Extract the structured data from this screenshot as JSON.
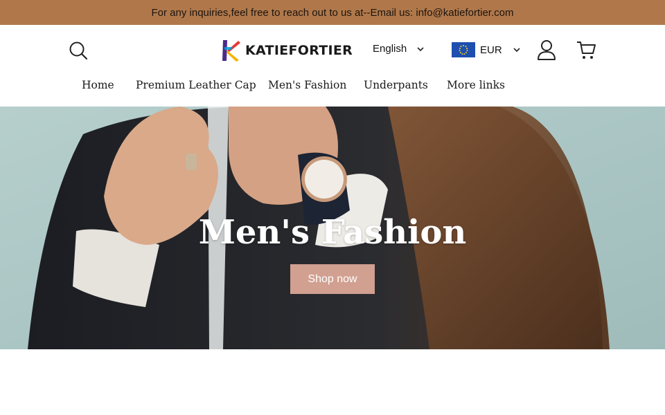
{
  "announcement": {
    "text": "For any inquiries,feel free to reach out to us at--Email us: info@katiefortier.com"
  },
  "header": {
    "logo_text": "KATIEFORTIER",
    "language": "English",
    "currency": "EUR",
    "icons": {
      "search": "search-icon",
      "account": "user-icon",
      "cart": "cart-icon",
      "flag": "eu-flag-icon"
    }
  },
  "nav": {
    "items": [
      {
        "label": "Home"
      },
      {
        "label": "Premium Leather Cap"
      },
      {
        "label": "Men's Fashion"
      },
      {
        "label": "Underpants"
      },
      {
        "label": "More links"
      }
    ]
  },
  "hero": {
    "title": "Men's Fashion",
    "button_label": "Shop now"
  },
  "colors": {
    "announcement_bg": "#b0784a",
    "button_bg": "#d1a090",
    "hero_sky": "#a9c4c3"
  }
}
